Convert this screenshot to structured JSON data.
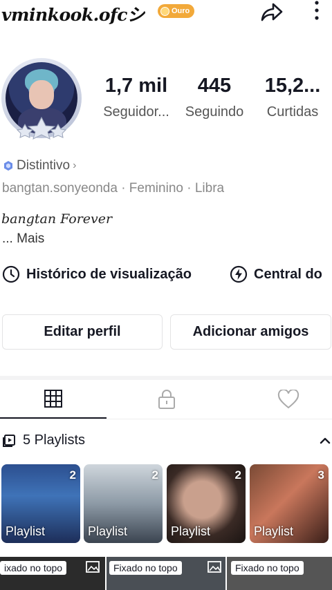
{
  "header": {
    "username": "vminkook.ofcシ",
    "badge": "Ouro",
    "share_icon": "share-arrow-icon",
    "more_icon": "more-vertical-icon"
  },
  "stats": [
    {
      "value": "1,7 mil",
      "label": "Seguidor..."
    },
    {
      "value": "445",
      "label": "Seguindo"
    },
    {
      "value": "15,2...",
      "label": "Curtidas"
    }
  ],
  "profile": {
    "distintivo": "Distintivo",
    "meta": "bangtan.sonyeonda · Feminino · Libra",
    "bio": "bangtan Forever",
    "more": "...  Mais"
  },
  "quick_links": [
    {
      "label": "Histórico de visualização",
      "icon": "clock-icon"
    },
    {
      "label": "Central do",
      "icon": "bolt-circle-icon"
    }
  ],
  "buttons": {
    "edit": "Editar perfil",
    "add": "Adicionar amigos"
  },
  "tabs": [
    {
      "icon": "grid-icon",
      "active": true
    },
    {
      "icon": "lock-icon",
      "active": false
    },
    {
      "icon": "heart-icon",
      "active": false
    }
  ],
  "playlists": {
    "header": "5 Playlists",
    "items": [
      {
        "label": "Playlist",
        "count": "2"
      },
      {
        "label": "Playlist",
        "count": "2"
      },
      {
        "label": "Playlist",
        "count": "2"
      },
      {
        "label": "Playlist",
        "count": "3"
      }
    ]
  },
  "pinned": [
    {
      "tag": "ixado no topo"
    },
    {
      "tag": "Fixado no topo"
    },
    {
      "tag": "Fixado no topo"
    }
  ]
}
